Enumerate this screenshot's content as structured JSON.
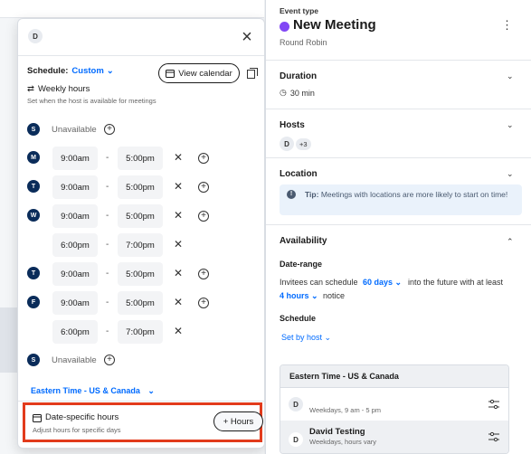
{
  "popup": {
    "avatar": "D",
    "schedule_label": "Schedule:",
    "schedule_value": "Custom",
    "view_calendar": "View calendar",
    "weekly_hours": "Weekly hours",
    "weekly_sub": "Set when the host is available for meetings",
    "days": [
      {
        "letter": "S",
        "unavailable": "Unavailable"
      },
      {
        "letter": "M",
        "start": "9:00am",
        "end": "5:00pm"
      },
      {
        "letter": "T",
        "start": "9:00am",
        "end": "5:00pm"
      },
      {
        "letter": "W",
        "start": "9:00am",
        "end": "5:00pm",
        "extra_start": "6:00pm",
        "extra_end": "7:00pm"
      },
      {
        "letter": "T",
        "start": "9:00am",
        "end": "5:00pm"
      },
      {
        "letter": "F",
        "start": "9:00am",
        "end": "5:00pm",
        "extra_start": "6:00pm",
        "extra_end": "7:00pm"
      },
      {
        "letter": "S",
        "unavailable": "Unavailable"
      }
    ],
    "timezone": "Eastern Time - US & Canada",
    "date_specific_title": "Date-specific hours",
    "date_specific_sub": "Adjust hours for specific days",
    "hours_button": "+ Hours"
  },
  "right": {
    "event_type_label": "Event type",
    "meeting_title": "New Meeting",
    "meeting_type": "Round Robin",
    "duration_label": "Duration",
    "duration_value": "30 min",
    "hosts_label": "Hosts",
    "hosts_avatar": "D",
    "hosts_more": "+3",
    "location_label": "Location",
    "tip_label": "Tip:",
    "tip_text": "Meetings with locations are more likely to start on time!",
    "availability_label": "Availability",
    "date_range_label": "Date-range",
    "invitees_text": "Invitees can schedule",
    "days_value": "60 days",
    "future_text": "into the future with at least",
    "notice_value": "4 hours",
    "notice_text": "notice",
    "schedule_label": "Schedule",
    "set_by_host": "Set by host",
    "tz_card_title": "Eastern Time - US & Canada",
    "tz_items": [
      {
        "avatar": "D",
        "name": "",
        "desc": "Weekdays, 9 am - 5 pm"
      },
      {
        "avatar": "D",
        "name": "David Testing",
        "desc": "Weekdays, hours vary"
      }
    ]
  },
  "colors": {
    "accent": "#006bff",
    "event_dot": "#8247f5",
    "day_dot": "#0a2c5a",
    "highlight": "#e23b1c"
  }
}
